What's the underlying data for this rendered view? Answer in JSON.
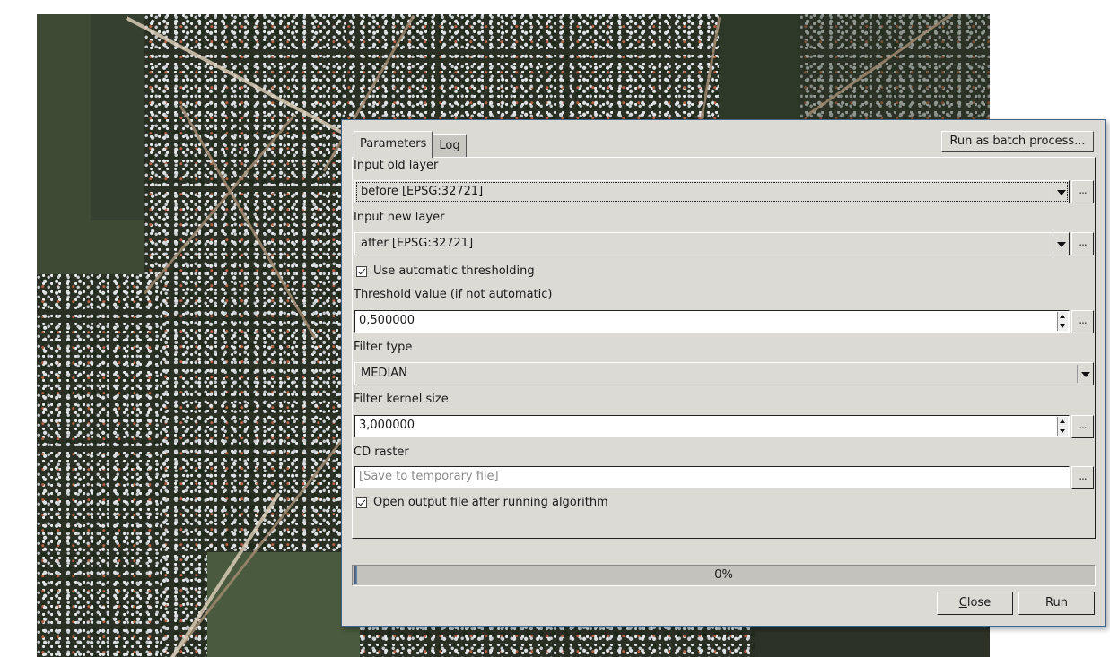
{
  "map": {
    "layer_type": "satellite-raster"
  },
  "dialog": {
    "tabs": [
      {
        "label": "Parameters",
        "active": true
      },
      {
        "label": "Log",
        "active": false
      }
    ],
    "batch_button": "Run as batch process...",
    "params": {
      "input_old_layer": {
        "label": "Input old layer",
        "value": "before [EPSG:32721]"
      },
      "input_new_layer": {
        "label": "Input new layer",
        "value": "after [EPSG:32721]"
      },
      "auto_threshold": {
        "label": "Use automatic thresholding",
        "checked": true
      },
      "threshold_value": {
        "label": "Threshold value (if not automatic)",
        "value": "0,500000"
      },
      "filter_type": {
        "label": "Filter type",
        "value": "MEDIAN"
      },
      "filter_kernel_size": {
        "label": "Filter kernel size",
        "value": "3,000000"
      },
      "cd_raster": {
        "label": "CD raster",
        "placeholder": "[Save to temporary file]",
        "value": ""
      },
      "open_output": {
        "label": "Open output file after running algorithm",
        "checked": true
      }
    },
    "browse_label": "...",
    "progress": {
      "percent": 0,
      "text": "0%"
    },
    "buttons": {
      "close_mnemonic": "C",
      "close_rest": "lose",
      "run": "Run"
    }
  }
}
